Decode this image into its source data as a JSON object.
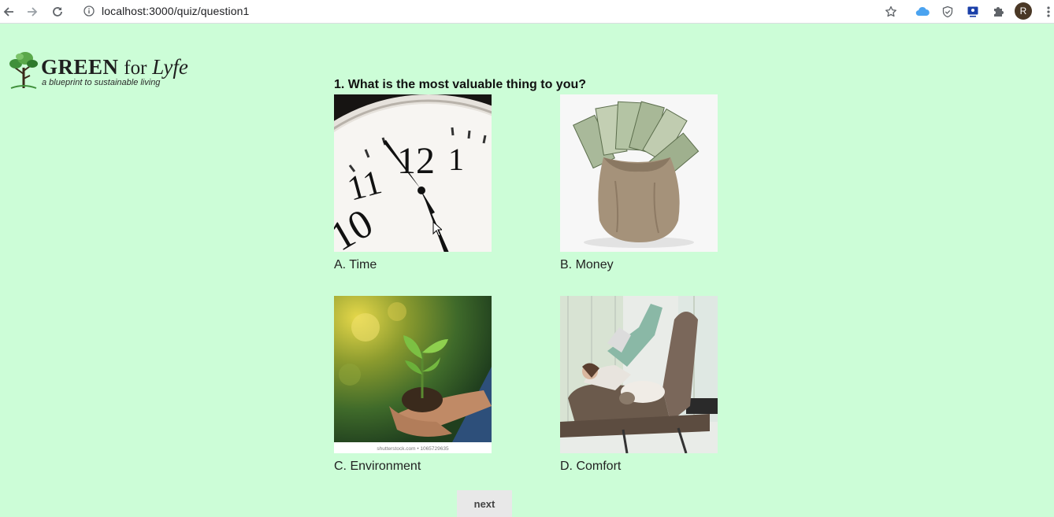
{
  "browser": {
    "url": "localhost:3000/quiz/question1",
    "profile_initial": "R",
    "icons": [
      "back-arrow-icon",
      "forward-arrow-icon",
      "reload-icon",
      "info-icon",
      "star-icon",
      "cloud-icon",
      "shield-icon",
      "screen-icon",
      "puzzle-icon",
      "more-vert-icon"
    ]
  },
  "logo": {
    "title_bold": "GREEN",
    "title_for": "for",
    "title_italic": "Lyfe",
    "tagline": "a blueprint to sustainable living"
  },
  "quiz": {
    "question": "1. What is the most valuable thing to you?",
    "options": [
      {
        "label": "A. Time",
        "image": "clock-image"
      },
      {
        "label": "B. Money",
        "image": "money-bag-image"
      },
      {
        "label": "C. Environment",
        "image": "seedling-hands-image"
      },
      {
        "label": "D. Comfort",
        "image": "relaxing-chair-image"
      }
    ],
    "watermark": "shutterstock.com • 1065729635",
    "next_label": "next"
  },
  "colors": {
    "page_background": "#ccfdd7",
    "button_background": "#e8e8e8"
  }
}
